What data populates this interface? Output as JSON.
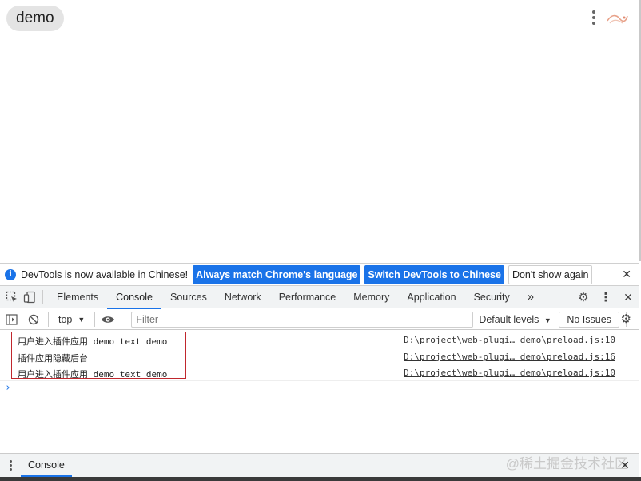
{
  "app": {
    "title_pill": "demo"
  },
  "banner": {
    "message": "DevTools is now available in Chinese!",
    "btn_match": "Always match Chrome's language",
    "btn_switch": "Switch DevTools to Chinese",
    "btn_dismiss": "Don't show again"
  },
  "tabs": {
    "items": [
      "Elements",
      "Console",
      "Sources",
      "Network",
      "Performance",
      "Memory",
      "Application",
      "Security"
    ],
    "active": "Console",
    "more": "»"
  },
  "filter": {
    "context": "top",
    "placeholder": "Filter",
    "levels": "Default levels",
    "issues": "No Issues"
  },
  "console": {
    "rows": [
      {
        "message": "用户进入插件应用 demo text demo",
        "source": "D:\\project\\web-plugi… demo\\preload.js:10"
      },
      {
        "message": "插件应用隐藏后台",
        "source": "D:\\project\\web-plugi… demo\\preload.js:16"
      },
      {
        "message": "用户进入插件应用 demo text demo",
        "source": "D:\\project\\web-plugi… demo\\preload.js:10"
      }
    ],
    "prompt": "›"
  },
  "drawer": {
    "tab": "Console",
    "watermark": "@稀土掘金技术社区"
  },
  "colors": {
    "accent": "#1a73e8",
    "highlight_border": "#c0272d"
  }
}
